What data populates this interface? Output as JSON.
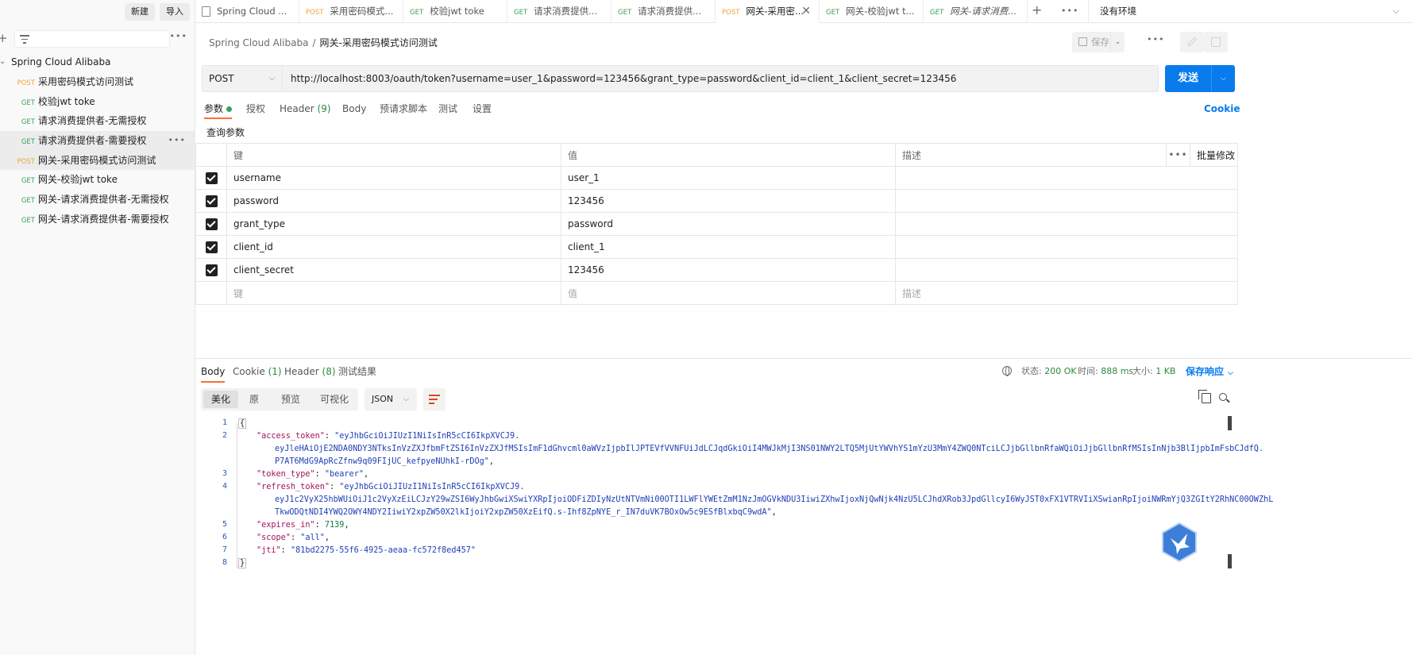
{
  "sidebar": {
    "new_label": "新建",
    "import_label": "导入",
    "collection_name": "Spring Cloud Alibaba",
    "items": [
      {
        "method": "POST",
        "label": "采用密码模式访问测试"
      },
      {
        "method": "GET",
        "label": "校验jwt toke"
      },
      {
        "method": "GET",
        "label": "请求消费提供者-无需授权"
      },
      {
        "method": "GET",
        "label": "请求消费提供者-需要授权"
      },
      {
        "method": "POST",
        "label": "网关-采用密码模式访问测试"
      },
      {
        "method": "GET",
        "label": "网关-校验jwt toke"
      },
      {
        "method": "GET",
        "label": "网关-请求消费提供者-无需授权"
      },
      {
        "method": "GET",
        "label": "网关-请求消费提供者-需要授权"
      }
    ]
  },
  "tabs": [
    {
      "method": "",
      "label": "Spring Cloud ..."
    },
    {
      "method": "POST",
      "label": "采用密码模式..."
    },
    {
      "method": "GET",
      "label": "校验jwt toke"
    },
    {
      "method": "GET",
      "label": "请求消费提供..."
    },
    {
      "method": "GET",
      "label": "请求消费提供..."
    },
    {
      "method": "POST",
      "label": "网关-采用密..."
    },
    {
      "method": "GET",
      "label": "网关-校验jwt t..."
    },
    {
      "method": "GET",
      "label": "网关-请求消费..."
    }
  ],
  "environment": "没有环境",
  "breadcrumb": {
    "parent": "Spring Cloud Alibaba",
    "separator": "/",
    "current": "网关-采用密码模式访问测试"
  },
  "save_label": "保存",
  "request": {
    "method": "POST",
    "url": "http://localhost:8003/oauth/token?username=user_1&password=123456&grant_type=password&client_id=client_1&client_secret=123456",
    "send_label": "发送"
  },
  "request_tabs": {
    "params": "参数",
    "auth": "授权",
    "header": "Header",
    "header_count": "(9)",
    "body": "Body",
    "prescript": "预请求脚本",
    "tests": "测试",
    "settings": "设置",
    "cookie": "Cookie"
  },
  "query_title": "查询参数",
  "params_table": {
    "headers": {
      "key": "键",
      "value": "值",
      "desc": "描述",
      "bulk": "批量修改"
    },
    "rows": [
      {
        "key": "username",
        "value": "user_1"
      },
      {
        "key": "password",
        "value": "123456"
      },
      {
        "key": "grant_type",
        "value": "password"
      },
      {
        "key": "client_id",
        "value": "client_1"
      },
      {
        "key": "client_secret",
        "value": "123456"
      }
    ],
    "placeholder": {
      "key": "键",
      "value": "值",
      "desc": "描述"
    }
  },
  "response_tabs": {
    "body": "Body",
    "cookie": "Cookie",
    "cookie_count": "(1)",
    "header": "Header",
    "header_count": "(8)",
    "tests": "测试结果"
  },
  "response_status": {
    "status_label": "状态:",
    "status_value": "200 OK",
    "time_label": "时间:",
    "time_value": "888 ms",
    "size_label": "大小:",
    "size_value": "1 KB",
    "save_response": "保存响应"
  },
  "view_modes": {
    "pretty": "美化",
    "raw": "原",
    "preview": "预览",
    "visualize": "可视化"
  },
  "format": "JSON",
  "response_body": {
    "access_token_key": "\"access_token\"",
    "access_token_l1": "\"eyJhbGciOiJIUzI1NiIsInR5cCI6IkpXVCJ9.",
    "access_token_l2": "eyJleHAiOjE2NDA0NDY3NTksInVzZXJfbmFtZSI6InVzZXJfMSIsImF1dGhvcml0aWVzIjpbIlJPTEVfVVNFUiJdLCJqdGkiOiI4MWJkMjI3NS01NWY2LTQ5MjUtYWVhYS1mYzU3MmY4ZWQ0NTciLCJjbGllbnRfaWQiOiJjbGllbnRfMSIsInNjb3BlIjpbImFsbCJdfQ.",
    "access_token_l3": "P7AT6MdG9ApRcZfnw9q09FIjUC_kefpyeNUhkI-rDOg\"",
    "token_type_key": "\"token_type\"",
    "token_type_val": "\"bearer\"",
    "refresh_token_key": "\"refresh_token\"",
    "refresh_token_l1": "\"eyJhbGciOiJIUzI1NiIsInR5cCI6IkpXVCJ9.",
    "refresh_token_l2": "eyJ1c2VyX25hbWUiOiJ1c2VyXzEiLCJzY29wZSI6WyJhbGwiXSwiYXRpIjoiODFiZDIyNzUtNTVmNi00OTI1LWFlYWEtZmM1NzJmOGVkNDU3IiwiZXhwIjoxNjQwNjk4NzU5LCJhdXRob3JpdGllcyI6WyJST0xFX1VTRVIiXSwianRpIjoiNWRmYjQ3ZGItY2RhNC00OWZhL",
    "refresh_token_l3": "TkwODQtNDI4YWQ2OWY4NDY2IiwiY2xpZW50X2lkIjoiY2xpZW50XzEifQ.s-Ihf8ZpNYE_r_IN7duVK7BOxOw5c9ESfBlxbqC9wdA\"",
    "expires_key": "\"expires_in\"",
    "expires_val": "7139",
    "scope_key": "\"scope\"",
    "scope_val": "\"all\"",
    "jti_key": "\"jti\"",
    "jti_val": "\"81bd2275-55f6-4925-aeaa-fc572f8ed457\"",
    "open_brace": "{",
    "close_brace": "}",
    "line_numbers": [
      "1",
      "2",
      "3",
      "4",
      "5",
      "6",
      "7",
      "8"
    ]
  },
  "colors": {
    "accent": "#097bed",
    "post": "#f2a23a",
    "get": "#3ca055",
    "active_tab": "#ff6c37"
  }
}
